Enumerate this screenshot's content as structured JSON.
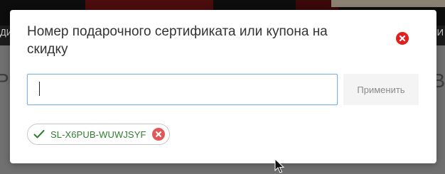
{
  "background": {
    "nav_left": "ДИ",
    "nav_right": "И",
    "heading_left": "Р",
    "heading_right": "ТВ"
  },
  "modal": {
    "title": "Номер подарочного сертификата или купона на скидку",
    "close_icon": "close-circle-icon",
    "input": {
      "value": "",
      "placeholder": ""
    },
    "apply_label": "Применить",
    "applied_coupon": {
      "code": "SL-X6PUB-WUWJSYF",
      "status_icon": "check-icon",
      "remove_icon": "remove-circle-icon"
    }
  },
  "colors": {
    "accent_red": "#e0201d",
    "success_green": "#2f7d2f",
    "input_focus_border": "#7fb4e0"
  }
}
